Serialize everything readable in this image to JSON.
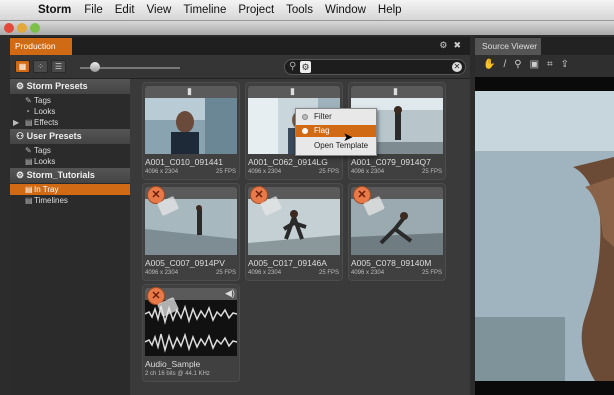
{
  "menubar": {
    "apple_icon": "apple-icon",
    "items": [
      "Storm",
      "File",
      "Edit",
      "View",
      "Timeline",
      "Project",
      "Tools",
      "Window",
      "Help"
    ]
  },
  "production_panel": {
    "tab_label": "Production",
    "tab_icons": [
      "gear-icon",
      "close-icon"
    ],
    "search": {
      "value": "",
      "icons": [
        "search-icon",
        "gear-icon",
        "clear-icon"
      ]
    },
    "search_menu": {
      "items": [
        "Filter",
        "Flag",
        "Open Template"
      ],
      "selected": "Flag"
    }
  },
  "tree": {
    "sections": [
      {
        "title": "Storm Presets",
        "items": [
          "Tags",
          "Looks",
          "Effects"
        ]
      },
      {
        "title": "User Presets",
        "items": [
          "Tags",
          "Looks"
        ]
      },
      {
        "title": "Storm_Tutorials",
        "items": [
          "In Tray",
          "Timelines"
        ]
      }
    ],
    "selected": "In Tray"
  },
  "clips": [
    {
      "name": "A001_C010_091441",
      "resolution": "4096 x 2304",
      "fps": "25 FPS",
      "rejected": false
    },
    {
      "name": "A001_C062_0914LG",
      "resolution": "4096 x 2304",
      "fps": "25 FPS",
      "rejected": false
    },
    {
      "name": "A001_C079_0914Q7",
      "resolution": "4096 x 2304",
      "fps": "25 FPS",
      "rejected": false
    },
    {
      "name": "A005_C007_0914PV",
      "resolution": "4096 x 2304",
      "fps": "25 FPS",
      "rejected": true
    },
    {
      "name": "A005_C017_09146A",
      "resolution": "4096 x 2304",
      "fps": "25 FPS",
      "rejected": true
    },
    {
      "name": "A005_C078_09140M",
      "resolution": "4096 x 2304",
      "fps": "25 FPS",
      "rejected": true
    },
    {
      "name": "Audio_Sample",
      "resolution": "2 ch 16 bits @ 44.1 KHz",
      "fps": "",
      "rejected": true
    }
  ],
  "source_viewer": {
    "tab_label": "Source Viewer",
    "tools": [
      "hand-icon",
      "pen-icon",
      "zoom-icon",
      "save-icon",
      "crop-icon",
      "export-icon"
    ]
  },
  "colors": {
    "accent": "#d06a14",
    "panel": "#3a3a3a",
    "reject": "#e87a4a"
  }
}
